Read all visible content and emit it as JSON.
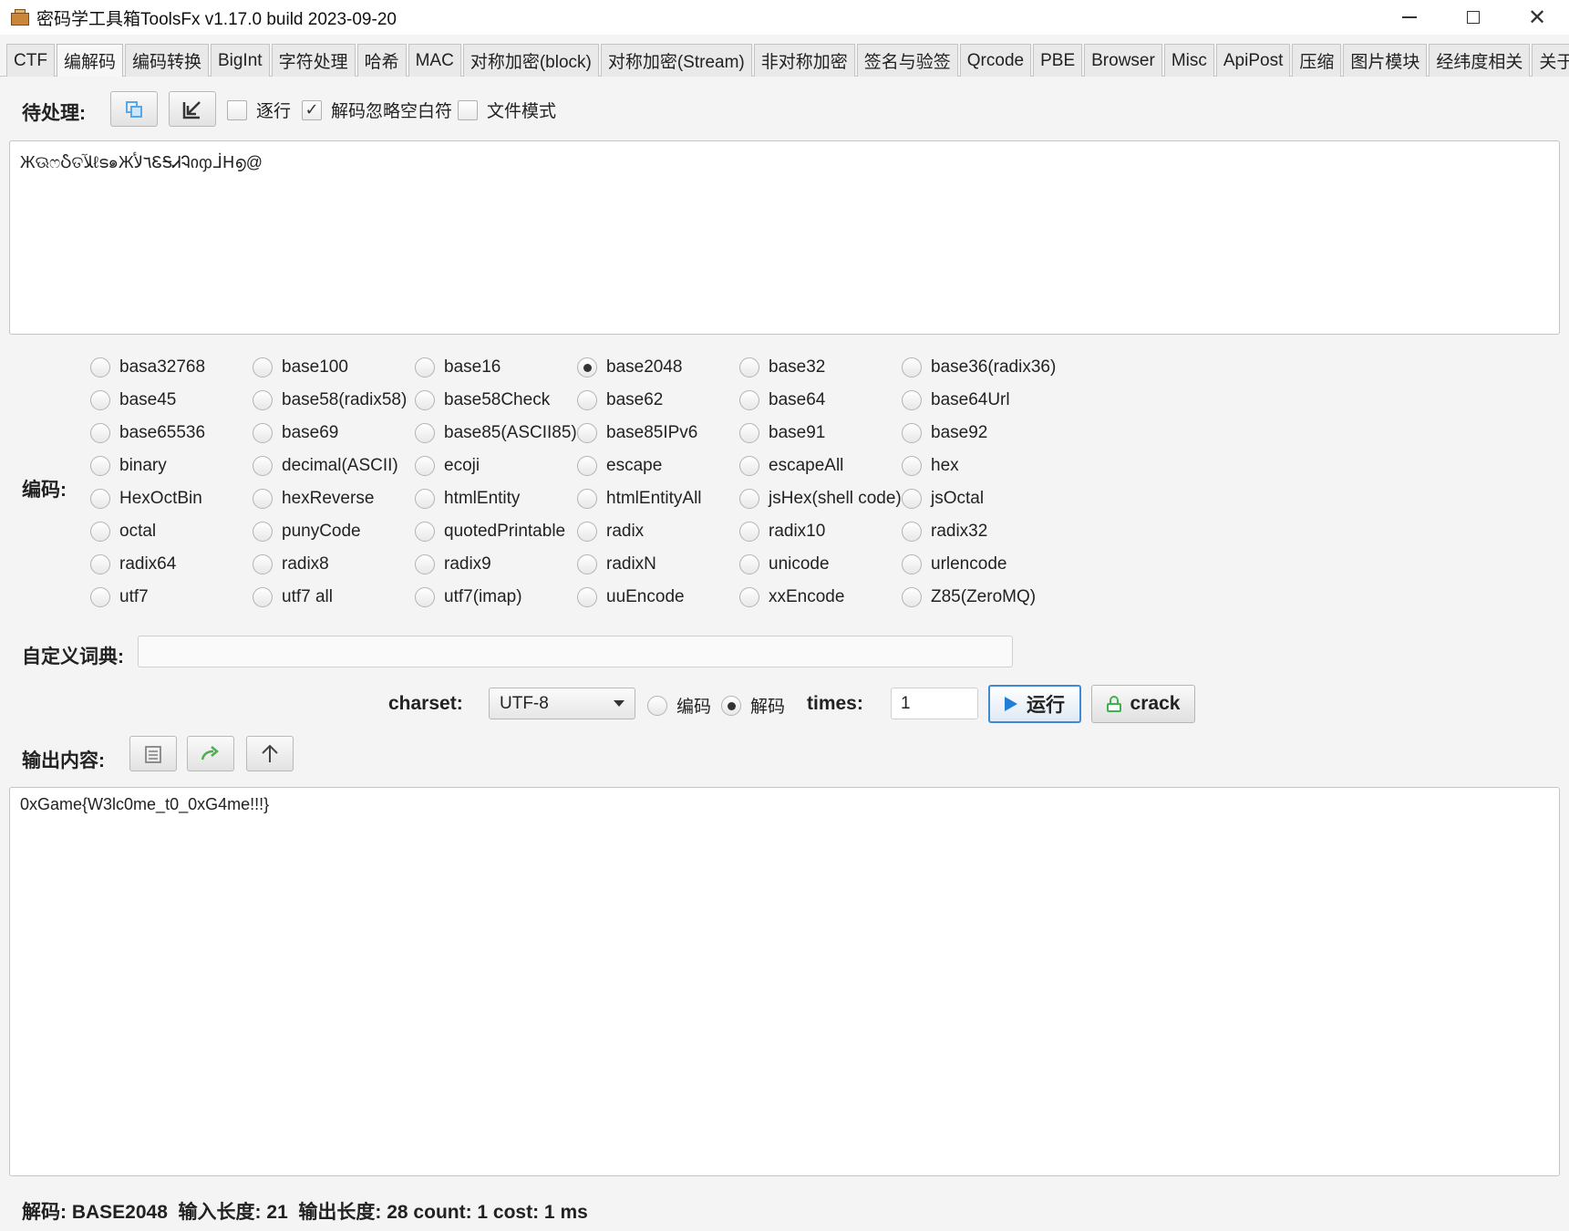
{
  "window": {
    "title": "密码学工具箱ToolsFx v1.17.0 build 2023-09-20"
  },
  "tabs": [
    {
      "label": "CTF"
    },
    {
      "label": "编解码"
    },
    {
      "label": "编码转换"
    },
    {
      "label": "BigInt"
    },
    {
      "label": "字符处理"
    },
    {
      "label": "哈希"
    },
    {
      "label": "MAC"
    },
    {
      "label": "对称加密(block)"
    },
    {
      "label": "对称加密(Stream)"
    },
    {
      "label": "非对称加密"
    },
    {
      "label": "签名与验签"
    },
    {
      "label": "Qrcode"
    },
    {
      "label": "PBE"
    },
    {
      "label": "Browser"
    },
    {
      "label": "Misc"
    },
    {
      "label": "ApiPost"
    },
    {
      "label": "压缩"
    },
    {
      "label": "图片模块"
    },
    {
      "label": "经纬度相关"
    },
    {
      "label": "关于"
    }
  ],
  "active_tab": "编解码",
  "input": {
    "label": "待处理:",
    "line_by_line_label": "逐行",
    "line_by_line_checked": false,
    "ignore_whitespace_label": "解码忽略空白符",
    "ignore_whitespace_checked": true,
    "file_mode_label": "文件模式",
    "file_mode_checked": false,
    "value": "ЖଊෆჂତﻶℓട๑Ж٦ﻷᏋᎦᏗᎸიჶᒨᕼ൭@"
  },
  "encoding": {
    "label": "编码:",
    "selected": "base2048",
    "options": [
      [
        "basa32768",
        "base100",
        "base16",
        "base2048",
        "base32",
        "base36(radix36)"
      ],
      [
        "base45",
        "base58(radix58)",
        "base58Check",
        "base62",
        "base64",
        "base64Url"
      ],
      [
        "base65536",
        "base69",
        "base85(ASCII85)",
        "base85IPv6",
        "base91",
        "base92"
      ],
      [
        "binary",
        "decimal(ASCII)",
        "ecoji",
        "escape",
        "escapeAll",
        "hex"
      ],
      [
        "HexOctBin",
        "hexReverse",
        "htmlEntity",
        "htmlEntityAll",
        "jsHex(shell code)",
        "jsOctal"
      ],
      [
        "octal",
        "punyCode",
        "quotedPrintable",
        "radix",
        "radix10",
        "radix32"
      ],
      [
        "radix64",
        "radix8",
        "radix9",
        "radixN",
        "unicode",
        "urlencode"
      ],
      [
        "utf7",
        "utf7 all",
        "utf7(imap)",
        "uuEncode",
        "xxEncode",
        "Z85(ZeroMQ)"
      ]
    ]
  },
  "custom_dict": {
    "label": "自定义词典:",
    "value": ""
  },
  "controls": {
    "charset_label": "charset:",
    "charset_value": "UTF-8",
    "encode_label": "编码",
    "decode_label": "解码",
    "mode": "decode",
    "times_label": "times:",
    "times_value": "1",
    "run_label": "运行",
    "crack_label": "crack"
  },
  "output": {
    "label": "输出内容:",
    "value": "0xGame{W3lc0me_t0_0xG4me!!!}"
  },
  "status": {
    "text": "解码: BASE2048  输入长度: 21  输出长度: 28 count: 1 cost: 1 ms"
  },
  "colors": {
    "accent": "#3d8bd6",
    "crack_icon": "#3fb24f",
    "forward_icon": "#4caf50"
  }
}
